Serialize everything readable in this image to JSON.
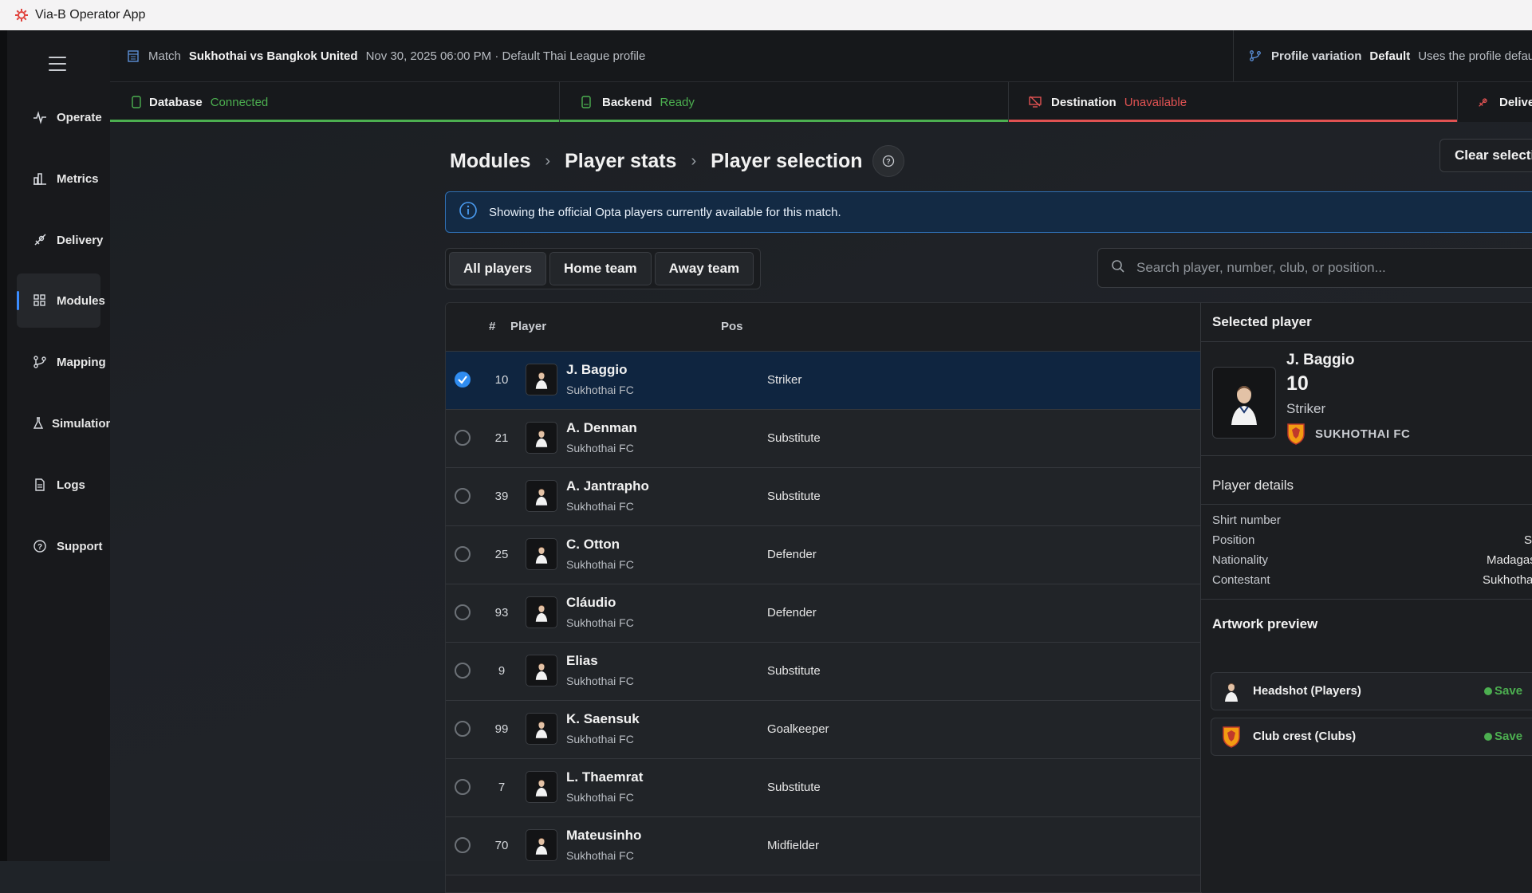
{
  "app": {
    "title": "Via-B Operator App"
  },
  "nav": {
    "items": [
      {
        "label": "Operate",
        "icon": "pulse-icon"
      },
      {
        "label": "Metrics",
        "icon": "bar-chart-icon"
      },
      {
        "label": "Delivery",
        "icon": "rocket-icon"
      },
      {
        "label": "Modules",
        "icon": "grid-icon",
        "active": true
      },
      {
        "label": "Mapping",
        "icon": "branch-icon"
      },
      {
        "label": "Simulation",
        "icon": "flask-icon"
      },
      {
        "label": "Logs",
        "icon": "document-icon"
      },
      {
        "label": "Support",
        "icon": "help-circle-icon"
      }
    ]
  },
  "topbar": {
    "match_label": "Match",
    "match_name": "Sukhothai vs Bangkok United",
    "match_meta": "Nov 30, 2025 06:00 PM · Default Thai League profile",
    "profile_label": "Profile variation",
    "profile_value": "Default",
    "profile_desc": "Uses the profile defau"
  },
  "status": {
    "database": {
      "label": "Database",
      "value": "Connected"
    },
    "backend": {
      "label": "Backend",
      "value": "Ready"
    },
    "destination": {
      "label": "Destination",
      "value": "Unavailable"
    },
    "delivery": {
      "label": "Delive"
    }
  },
  "breadcrumb": [
    "Modules",
    "Player stats",
    "Player selection"
  ],
  "clear_button": "Clear selecti",
  "info": "Showing the official Opta players currently available for this match.",
  "tabs": [
    "All players",
    "Home team",
    "Away team"
  ],
  "search": {
    "placeholder": "Search player, number, club, or position..."
  },
  "table": {
    "headers": {
      "num": "#",
      "player": "Player",
      "pos": "Pos"
    },
    "rows": [
      {
        "num": "10",
        "name": "J. Baggio",
        "club": "Sukhothai FC",
        "pos": "Striker",
        "selected": true
      },
      {
        "num": "21",
        "name": "A. Denman",
        "club": "Sukhothai FC",
        "pos": "Substitute"
      },
      {
        "num": "39",
        "name": "A. Jantrapho",
        "club": "Sukhothai FC",
        "pos": "Substitute"
      },
      {
        "num": "25",
        "name": "C. Otton",
        "club": "Sukhothai FC",
        "pos": "Defender"
      },
      {
        "num": "93",
        "name": "Cláudio",
        "club": "Sukhothai FC",
        "pos": "Defender"
      },
      {
        "num": "9",
        "name": "Elias",
        "club": "Sukhothai FC",
        "pos": "Substitute"
      },
      {
        "num": "99",
        "name": "K. Saensuk",
        "club": "Sukhothai FC",
        "pos": "Goalkeeper"
      },
      {
        "num": "7",
        "name": "L. Thaemrat",
        "club": "Sukhothai FC",
        "pos": "Substitute"
      },
      {
        "num": "70",
        "name": "Mateusinho",
        "club": "Sukhothai FC",
        "pos": "Midfielder"
      }
    ]
  },
  "panel": {
    "title": "Selected player",
    "name": "J. Baggio",
    "number": "10",
    "position": "Striker",
    "club": "SUKHOTHAI FC",
    "details_title": "Player details",
    "details": [
      {
        "label": "Shirt number",
        "value": ""
      },
      {
        "label": "Position",
        "value": "Stri"
      },
      {
        "label": "Nationality",
        "value": "Madagas"
      },
      {
        "label": "Contestant",
        "value": "Sukhothai"
      }
    ],
    "artwork_title": "Artwork preview",
    "artwork": [
      {
        "label": "Headshot (Players)",
        "status": "Save"
      },
      {
        "label": "Club crest (Clubs)",
        "status": "Save"
      }
    ]
  },
  "colors": {
    "accent": "#2f8cf0",
    "ok": "#4caf50",
    "error": "#e05252",
    "crest": "#f39c12"
  }
}
